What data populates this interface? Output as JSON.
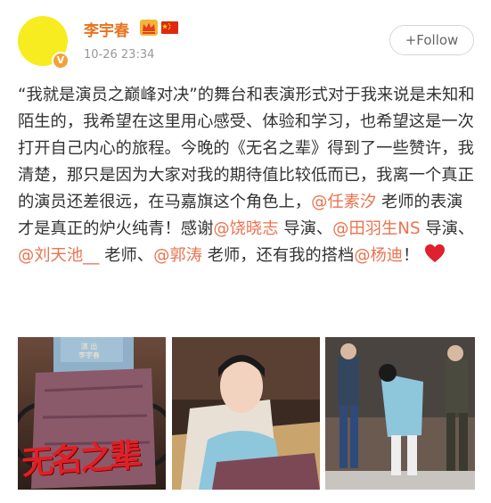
{
  "user": {
    "name": "李宇春",
    "timestamp": "10-26 23:34",
    "avatar_color": "#f7ec1f",
    "verified_badge": "V"
  },
  "follow": {
    "label": "+Follow"
  },
  "post": {
    "segments": [
      {
        "text": "“我就是演员之巅峰对决”的舞台和表演形式对于我来说是未知和陌生的，我希望在这里用心感受、体验和学习，也希望这是一次打开自己内心的旅程。今晚的《无名之辈》得到了一些赞许，我清楚，那只是因为大家对我的期待值比较低而已，我离一个真正的演员还差很远，在马嘉旗这个角色上，",
        "mention": false
      },
      {
        "text": "@任素汐",
        "mention": true
      },
      {
        "text": " 老师的表演才是真正的炉火纯青！感谢",
        "mention": false
      },
      {
        "text": "@饶晓志",
        "mention": true
      },
      {
        "text": " 导演、",
        "mention": false
      },
      {
        "text": "@田羽生NS",
        "mention": true
      },
      {
        "text": " 导演、",
        "mention": false
      },
      {
        "text": "@刘天池__",
        "mention": true
      },
      {
        "text": " 老师、",
        "mention": false
      },
      {
        "text": "@郭涛",
        "mention": true
      },
      {
        "text": " 老师，还有我的搭档",
        "mention": false
      },
      {
        "text": "@杨迪",
        "mention": true
      },
      {
        "text": "！",
        "mention": false
      }
    ],
    "emoji": "red-heart-icon",
    "mention_color": "#eb7350"
  },
  "photos": {
    "poster_caption_1": "演 出",
    "poster_caption_2": "李宇春",
    "poster_title": "无名之辈"
  }
}
